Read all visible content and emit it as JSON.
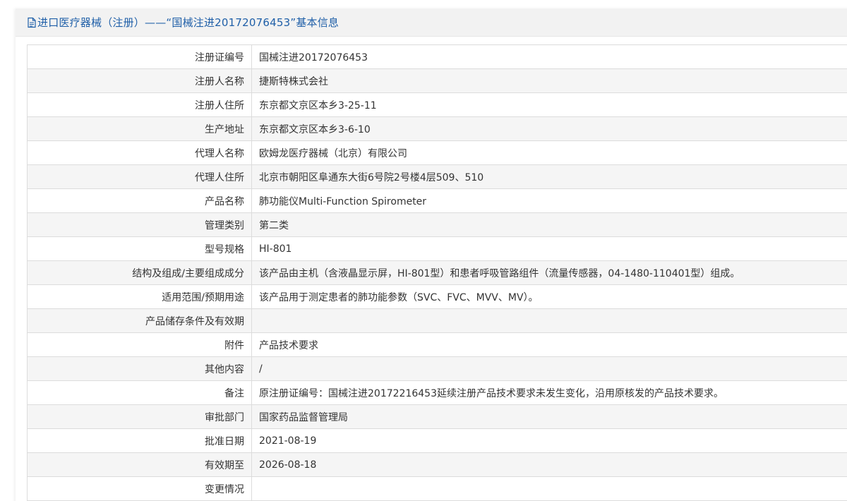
{
  "header": {
    "icon": "document-icon",
    "title": "进口医疗器械（注册）——“国械注进20172076453”基本信息"
  },
  "colors": {
    "title_blue": "#1f5fa8",
    "header_bg": "#f2f2f2",
    "row_alt_bg": "#f5f5f5",
    "border": "#dcdcdc"
  },
  "rows": [
    {
      "label": "注册证编号",
      "value": "国械注进20172076453"
    },
    {
      "label": "注册人名称",
      "value": "捷斯特株式会社"
    },
    {
      "label": "注册人住所",
      "value": "东京都文京区本乡3-25-11"
    },
    {
      "label": "生产地址",
      "value": "东京都文京区本乡3-6-10"
    },
    {
      "label": "代理人名称",
      "value": "欧姆龙医疗器械（北京）有限公司"
    },
    {
      "label": "代理人住所",
      "value": "北京市朝阳区阜通东大街6号院2号楼4层509、510"
    },
    {
      "label": "产品名称",
      "value": "肺功能仪Multi-Function Spirometer"
    },
    {
      "label": "管理类别",
      "value": "第二类"
    },
    {
      "label": "型号规格",
      "value": "HI-801"
    },
    {
      "label": "结构及组成/主要组成成分",
      "value": "该产品由主机（含液晶显示屏，HI-801型）和患者呼吸管路组件（流量传感器，04-1480-110401型）组成。"
    },
    {
      "label": "适用范围/预期用途",
      "value": "该产品用于测定患者的肺功能参数（SVC、FVC、MVV、MV）。"
    },
    {
      "label": "产品储存条件及有效期",
      "value": ""
    },
    {
      "label": "附件",
      "value": "产品技术要求"
    },
    {
      "label": "其他内容",
      "value": "/"
    },
    {
      "label": "备注",
      "value": "原注册证编号：国械注进20172216453延续注册产品技术要求未发生变化，沿用原核发的产品技术要求。"
    },
    {
      "label": "审批部门",
      "value": "国家药品监督管理局"
    },
    {
      "label": "批准日期",
      "value": "2021-08-19"
    },
    {
      "label": "有效期至",
      "value": "2026-08-18"
    },
    {
      "label": "变更情况",
      "value": ""
    }
  ]
}
